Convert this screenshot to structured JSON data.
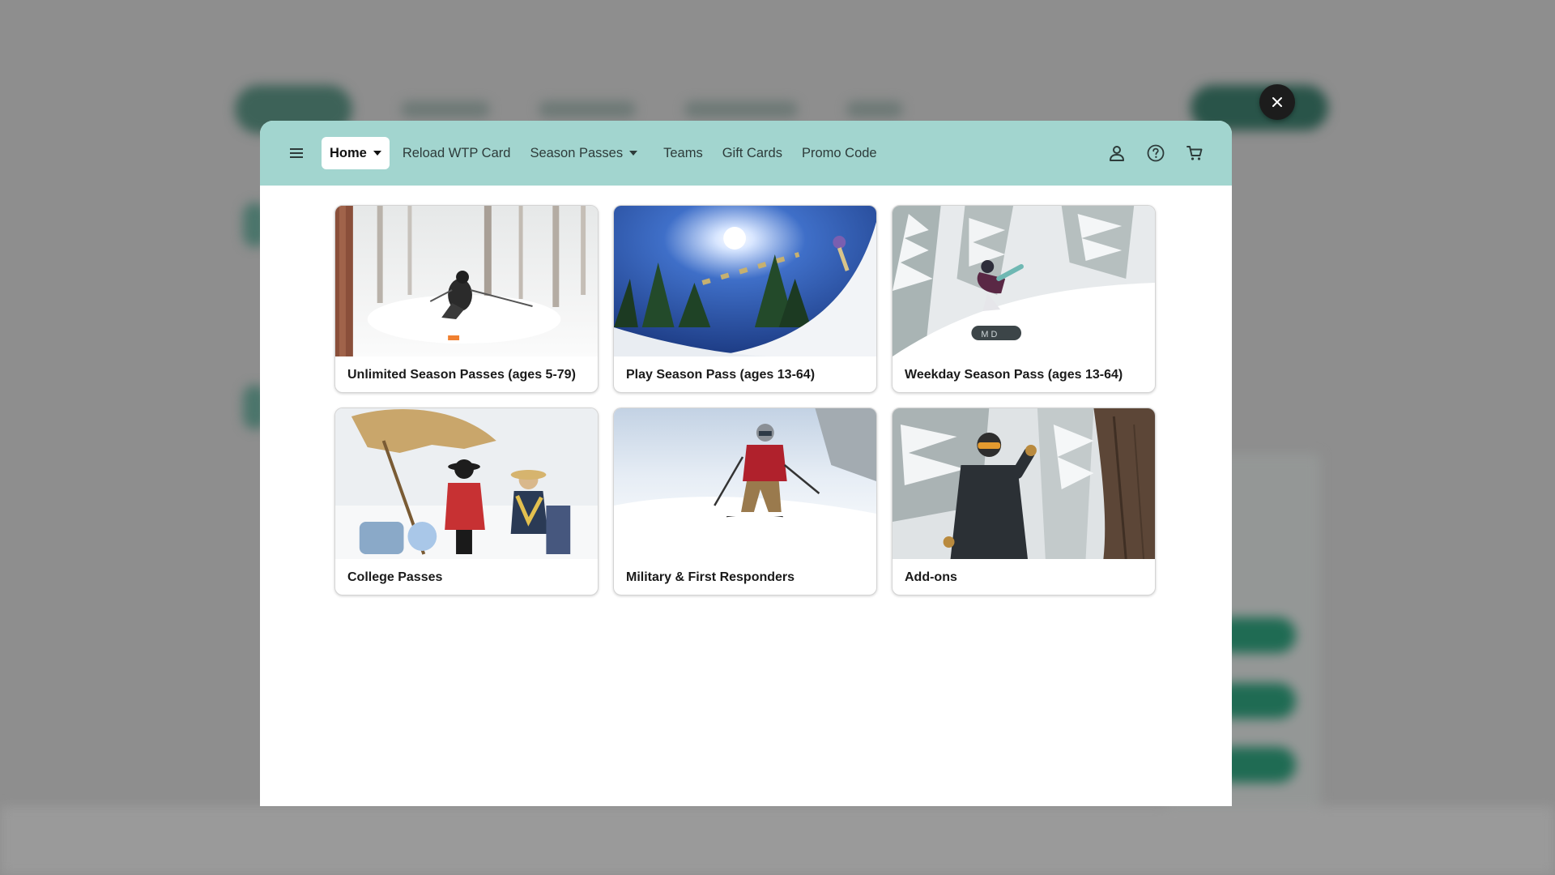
{
  "nav": {
    "items": [
      {
        "label": "Home",
        "active": true,
        "has_caret": true
      },
      {
        "label": "Reload WTP Card",
        "active": false,
        "has_caret": false
      },
      {
        "label": "Season Passes",
        "active": false,
        "has_caret": true
      },
      {
        "label": "Teams",
        "active": false,
        "has_caret": false
      },
      {
        "label": "Gift Cards",
        "active": false,
        "has_caret": false
      },
      {
        "label": "Promo Code",
        "active": false,
        "has_caret": false
      }
    ],
    "icons": {
      "menu": "hamburger-menu-icon",
      "account": "user-icon",
      "help": "help-circle-icon",
      "cart": "shopping-cart-icon",
      "close": "close-icon"
    }
  },
  "cards": [
    {
      "title": "Unlimited Season Passes (ages 5-79)",
      "scene": "skier-in-powder-trees"
    },
    {
      "title": "Play Season Pass (ages 13-64)",
      "scene": "terrain-park-jump-blue-sky"
    },
    {
      "title": "Weekday Season Pass (ages 13-64)",
      "scene": "snowboarder-snowy-trees"
    },
    {
      "title": "College Passes",
      "scene": "friends-under-umbrella"
    },
    {
      "title": "Military & First Responders",
      "scene": "skier-red-jacket"
    },
    {
      "title": "Add-ons",
      "scene": "person-by-tree-snow"
    }
  ],
  "colors": {
    "nav_bg": "#a2d5cf",
    "overlay_bg": "#8e8e8e",
    "close_bg": "#1c1c1c"
  }
}
